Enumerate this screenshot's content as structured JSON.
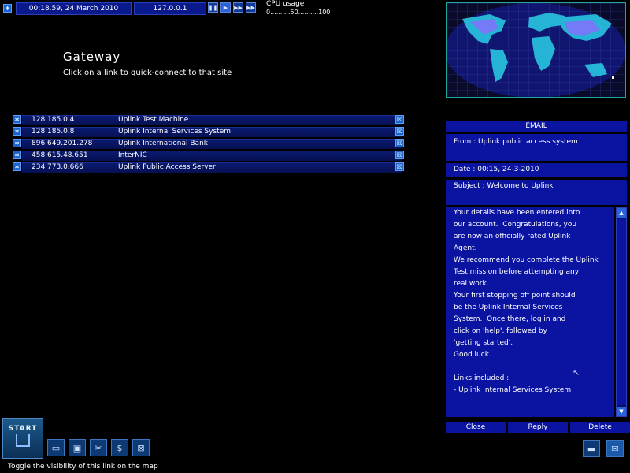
{
  "topbar": {
    "datetime": "00:18.59, 24 March 2010",
    "ip": "127.0.0.1",
    "cpu_label": "CPU usage",
    "cpu_scale": "0..........50..........100"
  },
  "gateway": {
    "title": "Gateway",
    "subtitle": "Click on a link to quick-connect to that site"
  },
  "links": [
    {
      "ip": "128.185.0.4",
      "name": "Uplink Test Machine"
    },
    {
      "ip": "128.185.0.8",
      "name": "Uplink Internal Services System"
    },
    {
      "ip": "896.649.201.278",
      "name": "Uplink International Bank"
    },
    {
      "ip": "458.615.48.651",
      "name": "InterNIC"
    },
    {
      "ip": "234.773.0.666",
      "name": "Uplink Public Access Server"
    }
  ],
  "email": {
    "header": "EMAIL",
    "from": "From : Uplink public access system",
    "date": "Date : 00:15, 24-3-2010",
    "subject": "Subject : Welcome to Uplink",
    "body": [
      "Your details have been entered into",
      "our account.  Congratulations, you",
      "are now an officially rated Uplink",
      "Agent.",
      "We recommend you complete the Uplink",
      "Test mission before attempting any",
      "real work.",
      "Your first stopping off point should",
      "be the Uplink Internal Services",
      "System.  Once there, log in and",
      "click on 'help', followed by",
      "'getting started'.",
      "Good luck.",
      "",
      "Links included :",
      "- Uplink Internal Services System"
    ],
    "close_label": "Close",
    "reply_label": "Reply",
    "delete_label": "Delete"
  },
  "start_label": "START",
  "status_tooltip": "Toggle the visibility of this link on the map",
  "colors": {
    "panel": "#0a14a0",
    "accent": "#2a62d8",
    "map_border": "#1aa89a"
  }
}
